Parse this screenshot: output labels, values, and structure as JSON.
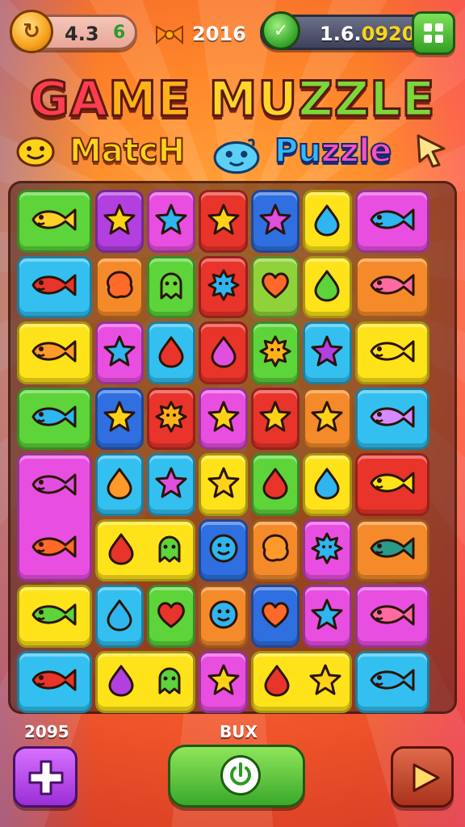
{
  "hud": {
    "coins": "4.3",
    "coin_bonus": "6",
    "candy": "2016",
    "gems_prefix": "1.6.",
    "gems_accent": "0920"
  },
  "title": {
    "part1": "GA",
    "part2": "ME ",
    "part3": "MU",
    "part4": "ZZLE",
    "match": "MatcH",
    "puzzle_a": "Pu",
    "puzzle_b": "zzle"
  },
  "bottom": {
    "score_label": "2095",
    "box_label": "BUX"
  },
  "colors": {
    "green": "#5cd43a",
    "purple": "#b23fe0",
    "magenta": "#e84fe0",
    "blue": "#2f6fe0",
    "cyan": "#33c0f0",
    "yellow": "#ffe31a",
    "orange": "#f58a2a",
    "red": "#e8342a",
    "lime": "#8fd23a"
  },
  "board": {
    "rows": [
      [
        {
          "span": 1.5,
          "bg": "green",
          "piece": "fish",
          "color": "#ffcf2a"
        },
        {
          "span": 1,
          "bg": "purple",
          "piece": "star",
          "color": "#ffd21a"
        },
        {
          "span": 1,
          "bg": "magenta",
          "piece": "star",
          "color": "#2fb5f0"
        },
        {
          "span": 1,
          "bg": "red",
          "piece": "star",
          "color": "#ffd21a"
        },
        {
          "span": 1,
          "bg": "blue",
          "piece": "star",
          "color": "#e04fe0"
        },
        {
          "span": 1,
          "bg": "yellow",
          "piece": "drop",
          "color": "#2fb5f0"
        },
        {
          "span": 1.5,
          "bg": "magenta",
          "piece": "fish",
          "color": "#2fb5f0"
        }
      ],
      [
        {
          "span": 1.5,
          "bg": "cyan",
          "piece": "fish",
          "color": "#e8342a"
        },
        {
          "span": 1,
          "bg": "orange",
          "piece": "blob",
          "color": "#ff6a2a"
        },
        {
          "span": 1,
          "bg": "green",
          "piece": "ghost",
          "color": "#6ad83a"
        },
        {
          "span": 1,
          "bg": "red",
          "piece": "burst",
          "color": "#2fb5f0"
        },
        {
          "span": 1,
          "bg": "lime",
          "piece": "heart",
          "color": "#ff6a2a"
        },
        {
          "span": 1,
          "bg": "yellow",
          "piece": "drop",
          "color": "#5cd43a"
        },
        {
          "span": 1.5,
          "bg": "orange",
          "piece": "fish",
          "color": "#ff6aa0"
        }
      ],
      [
        {
          "span": 1.5,
          "bg": "yellow",
          "piece": "fish",
          "color": "#ff9a2a"
        },
        {
          "span": 1,
          "bg": "magenta",
          "piece": "star",
          "color": "#2fb5f0"
        },
        {
          "span": 1,
          "bg": "cyan",
          "piece": "drop",
          "color": "#e8342a"
        },
        {
          "span": 1,
          "bg": "red",
          "piece": "drop",
          "color": "#e04fe0"
        },
        {
          "span": 1,
          "bg": "green",
          "piece": "burst",
          "color": "#ffb11a"
        },
        {
          "span": 1,
          "bg": "cyan",
          "piece": "star",
          "color": "#b23fe0"
        },
        {
          "span": 1.5,
          "bg": "yellow",
          "piece": "fish",
          "color": "#ffe31a"
        }
      ],
      [
        {
          "span": 1.5,
          "bg": "green",
          "piece": "fish",
          "color": "#2fb5f0"
        },
        {
          "span": 1,
          "bg": "blue",
          "piece": "star",
          "color": "#ffd21a"
        },
        {
          "span": 1,
          "bg": "red",
          "piece": "burst",
          "color": "#ffb11a"
        },
        {
          "span": 1,
          "bg": "magenta",
          "piece": "star",
          "color": "#ffd21a"
        },
        {
          "span": 1,
          "bg": "red",
          "piece": "star",
          "color": "#ffd21a"
        },
        {
          "span": 1,
          "bg": "orange",
          "piece": "star",
          "color": "#ffd21a"
        },
        {
          "span": 1.5,
          "bg": "cyan",
          "piece": "fish",
          "color": "#d58aff"
        }
      ],
      [
        {
          "span": 1.5,
          "bg": "magenta",
          "piece": "fish",
          "color": "#e04fe0",
          "tall": true,
          "piece2": "fish",
          "color2": "#ff6a2a"
        },
        {
          "span": 1,
          "bg": "cyan",
          "piece": "drop",
          "color": "#ff9a2a"
        },
        {
          "span": 1,
          "bg": "cyan",
          "piece": "star",
          "color": "#e04fe0"
        },
        {
          "span": 1,
          "bg": "yellow",
          "piece": "star",
          "color": "#ffd21a"
        },
        {
          "span": 1,
          "bg": "green",
          "piece": "drop",
          "color": "#e8342a"
        },
        {
          "span": 1,
          "bg": "yellow",
          "piece": "drop",
          "color": "#2fb5f0"
        },
        {
          "span": 1.5,
          "bg": "red",
          "piece": "fish",
          "color": "#ffe31a"
        }
      ],
      [
        {
          "span": 1.5,
          "bg": "skip"
        },
        {
          "span": 2,
          "bg": "yellow",
          "piece": "drop",
          "color": "#e8342a",
          "piece2": "ghost",
          "color2": "#5cd43a"
        },
        {
          "span": 1,
          "bg": "blue",
          "piece": "face",
          "color": "#2fb5f0"
        },
        {
          "span": 1,
          "bg": "orange",
          "piece": "blob",
          "color": "#ff9a2a"
        },
        {
          "span": 1,
          "bg": "magenta",
          "piece": "burst",
          "color": "#2fb5f0"
        },
        {
          "span": 1.5,
          "bg": "orange",
          "piece": "fish",
          "color": "#2a9a8a"
        }
      ],
      [
        {
          "span": 1.5,
          "bg": "yellow",
          "piece": "fish",
          "color": "#5cd43a"
        },
        {
          "span": 1,
          "bg": "cyan",
          "piece": "drop",
          "color": "#2fb5f0"
        },
        {
          "span": 1,
          "bg": "green",
          "piece": "heart",
          "color": "#e8342a"
        },
        {
          "span": 1,
          "bg": "orange",
          "piece": "face",
          "color": "#2fb5f0"
        },
        {
          "span": 1,
          "bg": "blue",
          "piece": "heart",
          "color": "#ff6a2a"
        },
        {
          "span": 1,
          "bg": "magenta",
          "piece": "star",
          "color": "#2fb5f0"
        },
        {
          "span": 1.5,
          "bg": "magenta",
          "piece": "fish",
          "color": "#ff6aa0"
        }
      ],
      [
        {
          "span": 1.5,
          "bg": "cyan",
          "piece": "fish",
          "color": "#e8342a"
        },
        {
          "span": 2,
          "bg": "yellow",
          "piece": "drop",
          "color": "#b23fe0",
          "piece2": "ghost",
          "color2": "#5cd43a"
        },
        {
          "span": 1,
          "bg": "magenta",
          "piece": "star",
          "color": "#ffd21a"
        },
        {
          "span": 2,
          "bg": "yellow",
          "piece": "drop",
          "color": "#e8342a",
          "piece2": "star",
          "color2": "#ffd21a"
        },
        {
          "span": 1.5,
          "bg": "cyan",
          "piece": "fish",
          "color": "#2fb5f0"
        }
      ]
    ]
  }
}
